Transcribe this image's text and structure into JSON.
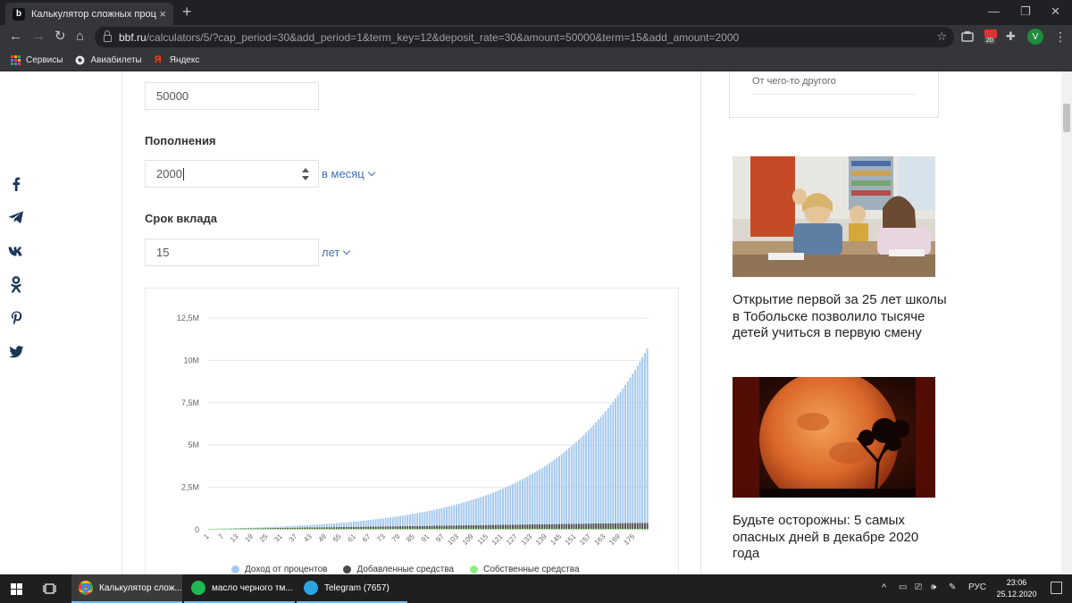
{
  "browser": {
    "tab_title": "Калькулятор сложных процентов",
    "url_host": "bbf.ru",
    "url_path": "/calculators/5/?cap_period=30&add_period=1&term_key=12&deposit_rate=30&amount=50000&term=15&add_amount=2000",
    "extension_badge": "20",
    "profile_initial": "V",
    "bookmarks": [
      "Сервисы",
      "Авиабилеты",
      "Яндекс"
    ]
  },
  "form": {
    "amount_value": "50000",
    "topup_label": "Пополнения",
    "topup_value": "2000",
    "topup_period": "в месяц",
    "term_label": "Срок вклада",
    "term_value": "15",
    "term_unit": "лет"
  },
  "chart_data": {
    "type": "bar",
    "stacked": true,
    "x_tick_labels": [
      "1",
      "7",
      "13",
      "19",
      "25",
      "31",
      "37",
      "43",
      "49",
      "55",
      "61",
      "67",
      "73",
      "79",
      "85",
      "91",
      "97",
      "103",
      "109",
      "115",
      "121",
      "127",
      "133",
      "139",
      "145",
      "151",
      "157",
      "163",
      "169",
      "175"
    ],
    "x_range": [
      1,
      180
    ],
    "y_tick_labels": [
      "0",
      "2,5M",
      "5M",
      "7,5M",
      "10M",
      "12,5M"
    ],
    "ylim": [
      0,
      12500000
    ],
    "grid": true,
    "legend_position": "bottom",
    "colors": {
      "interest": "#a4c8ee",
      "added": "#4a4a4a",
      "own": "#90ed7d"
    },
    "series": [
      {
        "name": "Доход от процентов",
        "model": "monthly_compound",
        "initial": 50000,
        "monthly_add": 2000,
        "annual_rate_percent": 30,
        "final_value": 10700000
      },
      {
        "name": "Добавленные средства",
        "model": "linear",
        "monthly_add": 2000,
        "final_value": 358000
      },
      {
        "name": "Собственные средства",
        "model": "constant",
        "value": 50000
      }
    ]
  },
  "sidebar": {
    "option_text": "От чего-то другого",
    "news": [
      {
        "title": "Открытие первой за 25 лет школы в Тобольске позволило тысяче детей учиться в первую смену"
      },
      {
        "title": "Будьте осторожны: 5 самых опасных дней в декабре 2020 года"
      }
    ]
  },
  "taskbar": {
    "items": [
      "Калькулятор слож...",
      "масло черного тм...",
      "Telegram (7657)"
    ],
    "language": "РУС",
    "time": "23:06",
    "date": "25.12.2020"
  }
}
